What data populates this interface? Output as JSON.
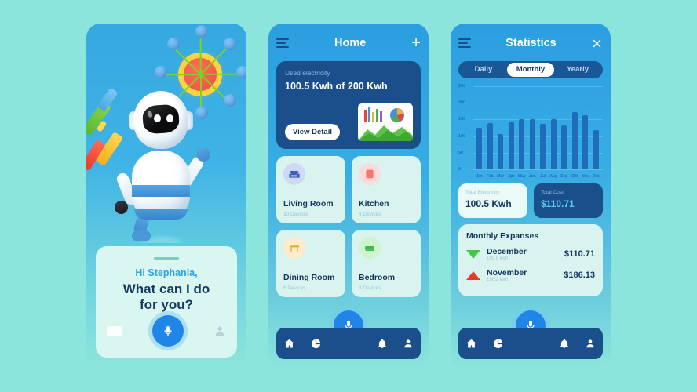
{
  "theme": {
    "background": "#8ce5dc",
    "accent": "#1f86e8",
    "navy": "#1a4f8c",
    "mint_card": "#d9f3ef"
  },
  "screen_assistant": {
    "greeting": "Hi Stephania,",
    "question_line1": "What can I do",
    "question_line2": "for you?",
    "mic_icon": "microphone-icon",
    "keyboard_icon": "keyboard-icon",
    "person_icon": "person-icon"
  },
  "screen_home": {
    "title": "Home",
    "menu_icon": "hamburger-menu-icon",
    "add_icon": "plus-icon",
    "electricity": {
      "label": "Used electricity",
      "value": "100.5 Kwh of 200 Kwh",
      "button": "View Detail",
      "thumbnail_icon": "chart-thumbnail-icon"
    },
    "rooms": [
      {
        "name": "Living Room",
        "devices": "10 Devices",
        "icon": "sofa-icon",
        "color": "#4a73c9"
      },
      {
        "name": "Kitchen",
        "devices": "4 Devices",
        "icon": "kitchen-icon",
        "color": "#f2786f"
      },
      {
        "name": "Dining Room",
        "devices": "6 Devices",
        "icon": "dining-table-icon",
        "color": "#f0b93c"
      },
      {
        "name": "Bedroom",
        "devices": "8 Devices",
        "icon": "bed-icon",
        "color": "#4cc95a"
      }
    ]
  },
  "screen_statistics": {
    "title": "Statistics",
    "menu_icon": "hamburger-menu-icon",
    "close_icon": "close-icon",
    "tabs": [
      {
        "label": "Daily",
        "active": false
      },
      {
        "label": "Monthly",
        "active": true
      },
      {
        "label": "Yearly",
        "active": false
      }
    ],
    "summary": [
      {
        "label": "Total Electricity",
        "value": "100.5 Kwh",
        "style": "light"
      },
      {
        "label": "Total Cost",
        "value": "$110.71",
        "style": "dark"
      }
    ],
    "expenses": {
      "heading": "Monthly Expanses",
      "rows": [
        {
          "month": "December",
          "kwh": "100.5 kwh",
          "amount": "$110.71",
          "trend": "down",
          "trend_icon": "triangle-down-icon"
        },
        {
          "month": "November",
          "kwh": "186.2 kwh",
          "amount": "$186.13",
          "trend": "up",
          "trend_icon": "triangle-up-icon"
        }
      ]
    }
  },
  "chart_data": {
    "type": "bar",
    "title": "Statistics",
    "categories": [
      "Jan",
      "Feb",
      "Mar",
      "Apr",
      "May",
      "Jun",
      "Jul",
      "Aug",
      "Sep",
      "Oct",
      "Nov",
      "Dec"
    ],
    "values": [
      125,
      140,
      105,
      145,
      152,
      152,
      137,
      150,
      133,
      172,
      163,
      118
    ],
    "yticks": [
      250,
      200,
      150,
      100,
      50,
      0
    ],
    "ylim": [
      0,
      250
    ],
    "xlabel": "",
    "ylabel": "",
    "grid": true,
    "legend": "none",
    "bar_color": "#1f6dba"
  },
  "bottom_nav": [
    {
      "icon": "home-icon",
      "label": "Home"
    },
    {
      "icon": "pie-chart-icon",
      "label": "Statistics"
    },
    {
      "icon": "microphone-icon",
      "label": "Voice"
    },
    {
      "icon": "bell-icon",
      "label": "Notifications"
    },
    {
      "icon": "person-icon",
      "label": "Profile"
    }
  ]
}
